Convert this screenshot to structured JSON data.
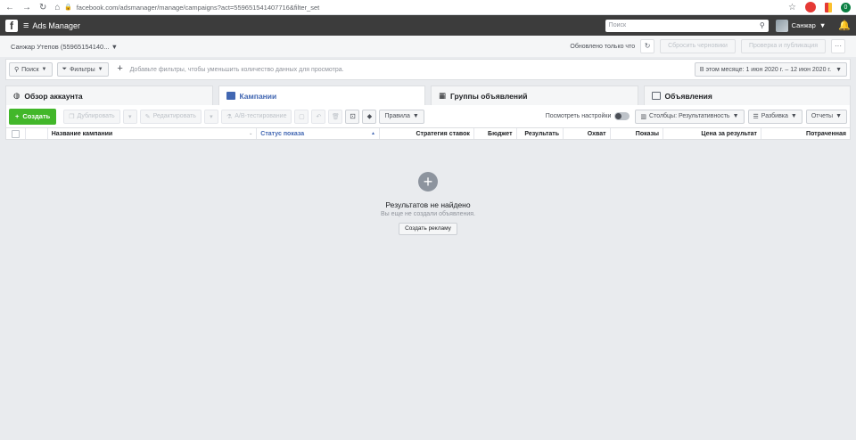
{
  "browser": {
    "url": "facebook.com/adsmanager/manage/campaigns?act=559651541407716&filter_set",
    "ext_badge": "0"
  },
  "topbar": {
    "logo": "f",
    "app_title": "Ads Manager",
    "search_placeholder": "Поиск",
    "user_name": "Санжар"
  },
  "account": {
    "name": "Санжар Утепов (55965154140...",
    "updated_label": "Обновлено только что",
    "discard_label": "Сбросить черновики",
    "review_label": "Проверка и публикация",
    "more_label": "···"
  },
  "filters": {
    "search_label": "Поиск",
    "filters_label": "Фильтры",
    "hint": "Добавьте фильтры, чтобы уменьшить количество данных для просмотра.",
    "date_range": "В этом месяце: 1 июн 2020 г. – 12 июн 2020 г."
  },
  "tabs": [
    {
      "label": "Обзор аккаунта"
    },
    {
      "label": "Кампании"
    },
    {
      "label": "Группы объявлений"
    },
    {
      "label": "Объявления"
    }
  ],
  "toolbar": {
    "create_label": "Создать",
    "duplicate_label": "Дублировать",
    "edit_label": "Редактировать",
    "ab_label": "A/B-тестирование",
    "rules_label": "Правила",
    "view_settings_label": "Посмотреть настройки",
    "columns_label": "Столбцы: Результативность",
    "breakdown_label": "Разбивка",
    "reports_label": "Отчеты"
  },
  "table": {
    "columns": [
      "Название кампании",
      "Статус показа",
      "Стратегия ставок",
      "Бюджет",
      "Результать",
      "Охват",
      "Показы",
      "Цена за результат",
      "Потраченная"
    ]
  },
  "empty_state": {
    "title": "Результатов не найдено",
    "subtitle": "Вы еще не создали объявления.",
    "button": "Создать рекламу"
  }
}
